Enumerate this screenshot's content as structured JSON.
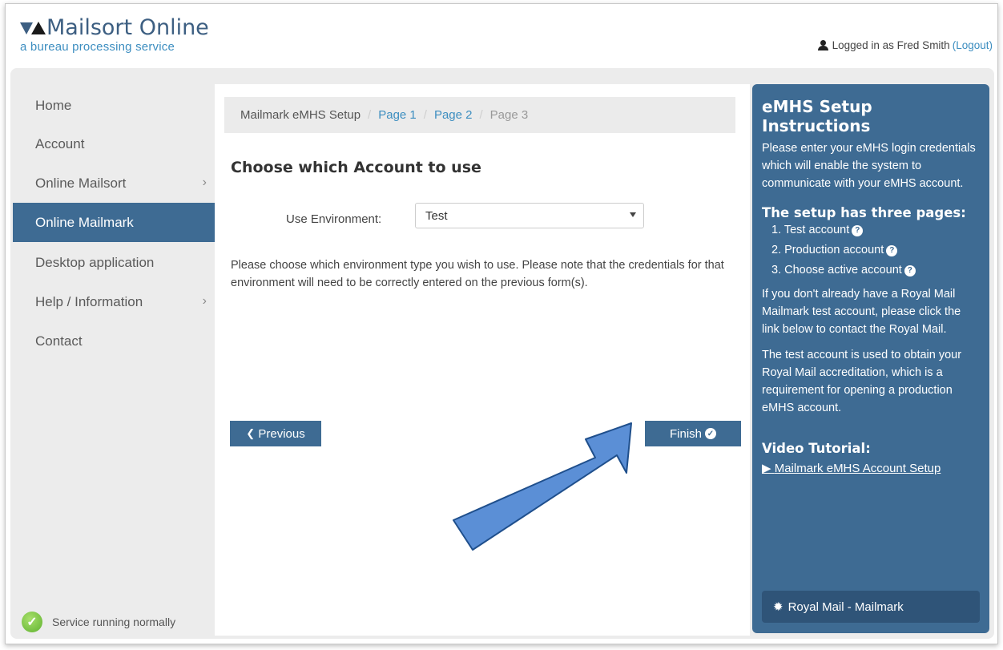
{
  "header": {
    "app_title": "Mailsort Online",
    "subtitle": "a bureau processing service",
    "login_prefix": "Logged in as Fred Smith",
    "logout_label": "(Logout)"
  },
  "sidebar": {
    "items": [
      {
        "label": "Home"
      },
      {
        "label": "Account"
      },
      {
        "label": "Online Mailsort"
      },
      {
        "label": "Online Mailmark"
      },
      {
        "label": "Desktop application"
      },
      {
        "label": "Help / Information"
      },
      {
        "label": "Contact"
      }
    ],
    "status_text": "Service running normally"
  },
  "breadcrumb": {
    "root": "Mailmark eMHS Setup",
    "page1": "Page 1",
    "page2": "Page 2",
    "page3": "Page 3"
  },
  "main": {
    "title": "Choose which Account to use",
    "env_label": "Use Environment:",
    "env_value": "Test",
    "help_text": "Please choose which environment type you wish to use. Please note that the credentials for that environment will need to be correctly entered on the previous form(s).",
    "previous_label": "Previous",
    "finish_label": "Finish"
  },
  "panel": {
    "title": "eMHS Setup Instructions",
    "intro": "Please enter your eMHS login credentials which will enable the system to communicate with your eMHS account.",
    "setup_heading": "The setup has three pages:",
    "steps": [
      "1. Test account",
      "2. Production account",
      "3. Choose active account"
    ],
    "para_test": "If you don't already have a Royal Mail Mailmark test account, please click the link below to contact the Royal Mail.",
    "para_accreditation": "The test account is used to obtain your Royal Mail accreditation, which is a requirement for opening a production eMHS account.",
    "video_heading": "Video Tutorial:",
    "video_link": "Mailmark eMHS Account Setup",
    "royal_mail_link": "Royal Mail - Mailmark"
  },
  "colors": {
    "accent": "#3e6b93",
    "link": "#3d8ec0",
    "annotation_arrow": "#5b8fd6"
  }
}
